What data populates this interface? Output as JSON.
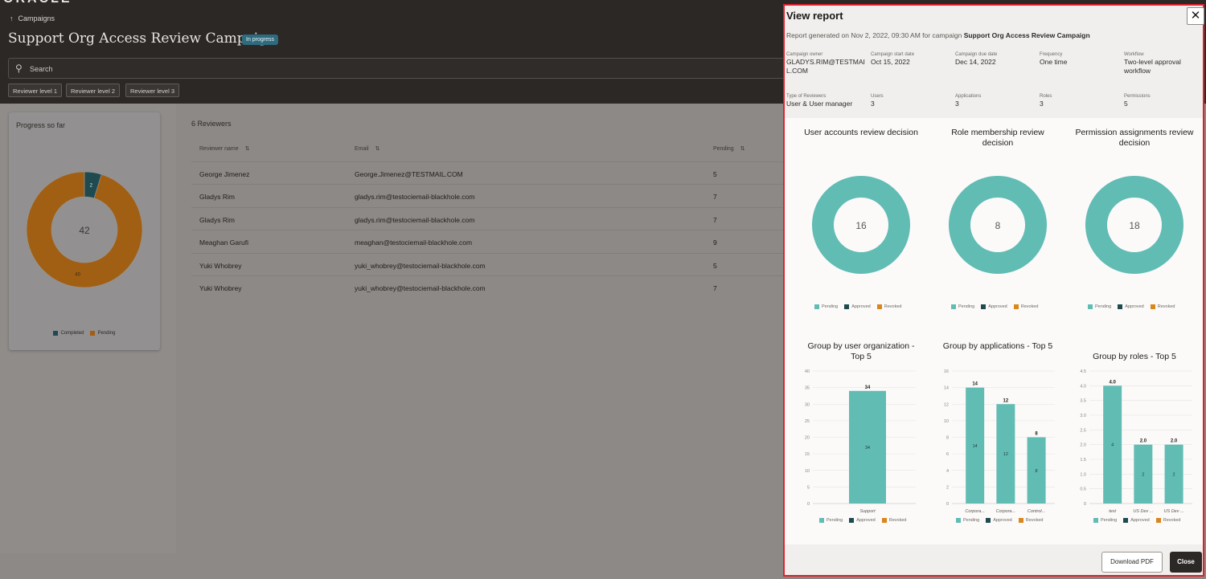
{
  "app": {
    "logo": "ORACLE"
  },
  "breadcrumb": {
    "label": "Campaigns"
  },
  "campaign": {
    "title": "Support Org Access Review Campaign",
    "status": "In progress"
  },
  "search": {
    "placeholder": "Search"
  },
  "levels": [
    "Reviewer level 1",
    "Reviewer level 2",
    "Reviewer level 3"
  ],
  "progress": {
    "title": "Progress so far",
    "completed": 2,
    "pending": 40,
    "total": 42,
    "legend": [
      "Completed",
      "Pending"
    ],
    "colors": {
      "completed": "#1f4b50",
      "pending": "#a15f14"
    }
  },
  "reviewers": {
    "count_label": "6 Reviewers",
    "columns": [
      "Reviewer name",
      "Email",
      "Pending"
    ],
    "rows": [
      {
        "name": "George Jimenez",
        "email": "George.Jimenez@TESTMAIL.COM",
        "pending": "5"
      },
      {
        "name": "Gladys Rim",
        "email": "gladys.rim@testociemail-blackhole.com",
        "pending": "7"
      },
      {
        "name": "Gladys Rim",
        "email": "gladys.rim@testociemail-blackhole.com",
        "pending": "7"
      },
      {
        "name": "Meaghan Garufi",
        "email": "meaghan@testociemail-blackhole.com",
        "pending": "9"
      },
      {
        "name": "Yuki Whobrey",
        "email": "yuki_whobrey@testociemail-blackhole.com",
        "pending": "5"
      },
      {
        "name": "Yuki Whobrey",
        "email": "yuki_whobrey@testociemail-blackhole.com",
        "pending": "7"
      }
    ]
  },
  "report": {
    "title": "View report",
    "generated_prefix": "Report generated on Nov 2, 2022, 09:30 AM for campaign",
    "generated_campaign": "Support Org Access Review Campaign",
    "meta": [
      {
        "label": "Campaign owner",
        "value": "GLADYS.RIM@TESTMAIL.COM"
      },
      {
        "label": "Campaign start date",
        "value": "Oct 15, 2022"
      },
      {
        "label": "Campaign due date",
        "value": "Dec 14, 2022"
      },
      {
        "label": "Frequency",
        "value": "One time"
      },
      {
        "label": "Workflow",
        "value": "Two-level approval workflow"
      },
      {
        "label": "Type of Reviewers",
        "value": "User & User manager"
      },
      {
        "label": "Users",
        "value": "3"
      },
      {
        "label": "Applications",
        "value": "3"
      },
      {
        "label": "Roles",
        "value": "3"
      },
      {
        "label": "Permissions",
        "value": "5"
      }
    ],
    "legend": [
      "Pending",
      "Approved",
      "Revoked"
    ],
    "colors": {
      "pending": "#61bcb4",
      "approved": "#1f4b50",
      "revoked": "#d9861c"
    },
    "download_label": "Download PDF",
    "close_label": "Close",
    "close_icon": "close-icon"
  },
  "chart_data": [
    {
      "type": "pie",
      "title": "User accounts review decision",
      "categories": [
        "Pending",
        "Approved",
        "Revoked"
      ],
      "values": [
        16,
        0,
        0
      ],
      "center_label": "16"
    },
    {
      "type": "pie",
      "title": "Role membership review decision",
      "categories": [
        "Pending",
        "Approved",
        "Revoked"
      ],
      "values": [
        8,
        0,
        0
      ],
      "center_label": "8"
    },
    {
      "type": "pie",
      "title": "Permission assignments review decision",
      "categories": [
        "Pending",
        "Approved",
        "Revoked"
      ],
      "values": [
        18,
        0,
        0
      ],
      "center_label": "18"
    },
    {
      "type": "bar",
      "title": "Group by user organization - Top 5",
      "categories": [
        "Support"
      ],
      "values": [
        34
      ],
      "top_labels": [
        "34"
      ],
      "inner_labels": [
        "34"
      ],
      "ylim": [
        0,
        40
      ],
      "yticks": [
        "0",
        "5",
        "10",
        "15",
        "20",
        "25",
        "30",
        "35",
        "40"
      ]
    },
    {
      "type": "bar",
      "title": "Group by applications - Top 5",
      "categories": [
        "Corpora...",
        "Corpora...",
        "Control..."
      ],
      "values": [
        14,
        12,
        8
      ],
      "top_labels": [
        "14",
        "12",
        "8"
      ],
      "inner_labels": [
        "14",
        "12",
        "8"
      ],
      "ylim": [
        0,
        16
      ],
      "yticks": [
        "0",
        "2",
        "4",
        "6",
        "8",
        "10",
        "12",
        "14",
        "16"
      ]
    },
    {
      "type": "bar",
      "title": "Group by roles - Top 5",
      "categories": [
        "test",
        "US Dev ...",
        "US Dev ..."
      ],
      "values": [
        4,
        2,
        2
      ],
      "top_labels": [
        "4.0",
        "2.0",
        "2.0"
      ],
      "inner_labels": [
        "4",
        "2",
        "2"
      ],
      "ylim": [
        0,
        4.5
      ],
      "yticks": [
        "0",
        "0.5",
        "1.0",
        "1.5",
        "2.0",
        "2.5",
        "3.0",
        "3.5",
        "4.0",
        "4.5"
      ]
    }
  ]
}
